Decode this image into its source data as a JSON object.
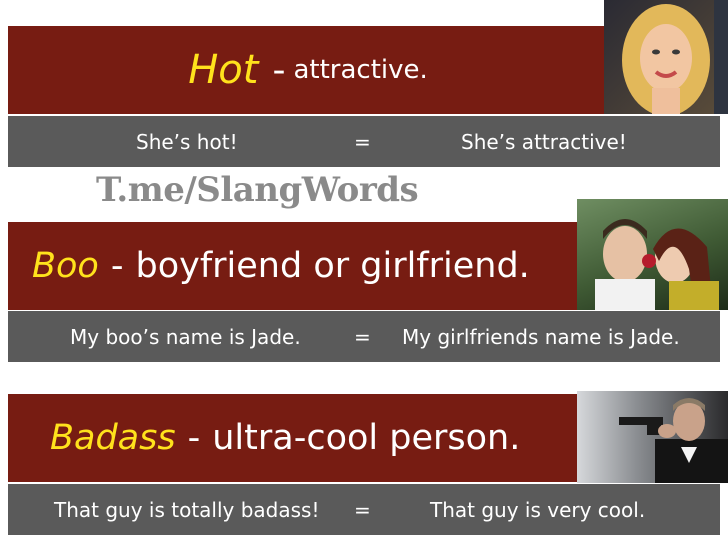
{
  "watermark": "T.me/SlangWords",
  "rows": [
    {
      "keyword": "Hot",
      "dash": "-",
      "definition": "attractive.",
      "example_left": "She’s hot!",
      "equals": "=",
      "example_right": "She’s attractive!"
    },
    {
      "keyword": "Boo",
      "dash": "-",
      "definition": "boyfriend or girlfriend.",
      "example_left": "My boo’s name is Jade.",
      "equals": "=",
      "example_right": "My girlfriends name is Jade."
    },
    {
      "keyword": "Badass",
      "dash": "-",
      "definition": "ultra-cool person.",
      "example_left": "That guy is totally badass!",
      "equals": "=",
      "example_right": "That guy is very cool."
    }
  ],
  "colors": {
    "title_band": "#771c12",
    "keyword": "#ffe21c",
    "example_band": "#5a5a5a",
    "watermark": "#8a8a8a"
  },
  "images": [
    "blonde-woman-photo",
    "couple-with-rose-photo",
    "man-with-gun-photo"
  ]
}
